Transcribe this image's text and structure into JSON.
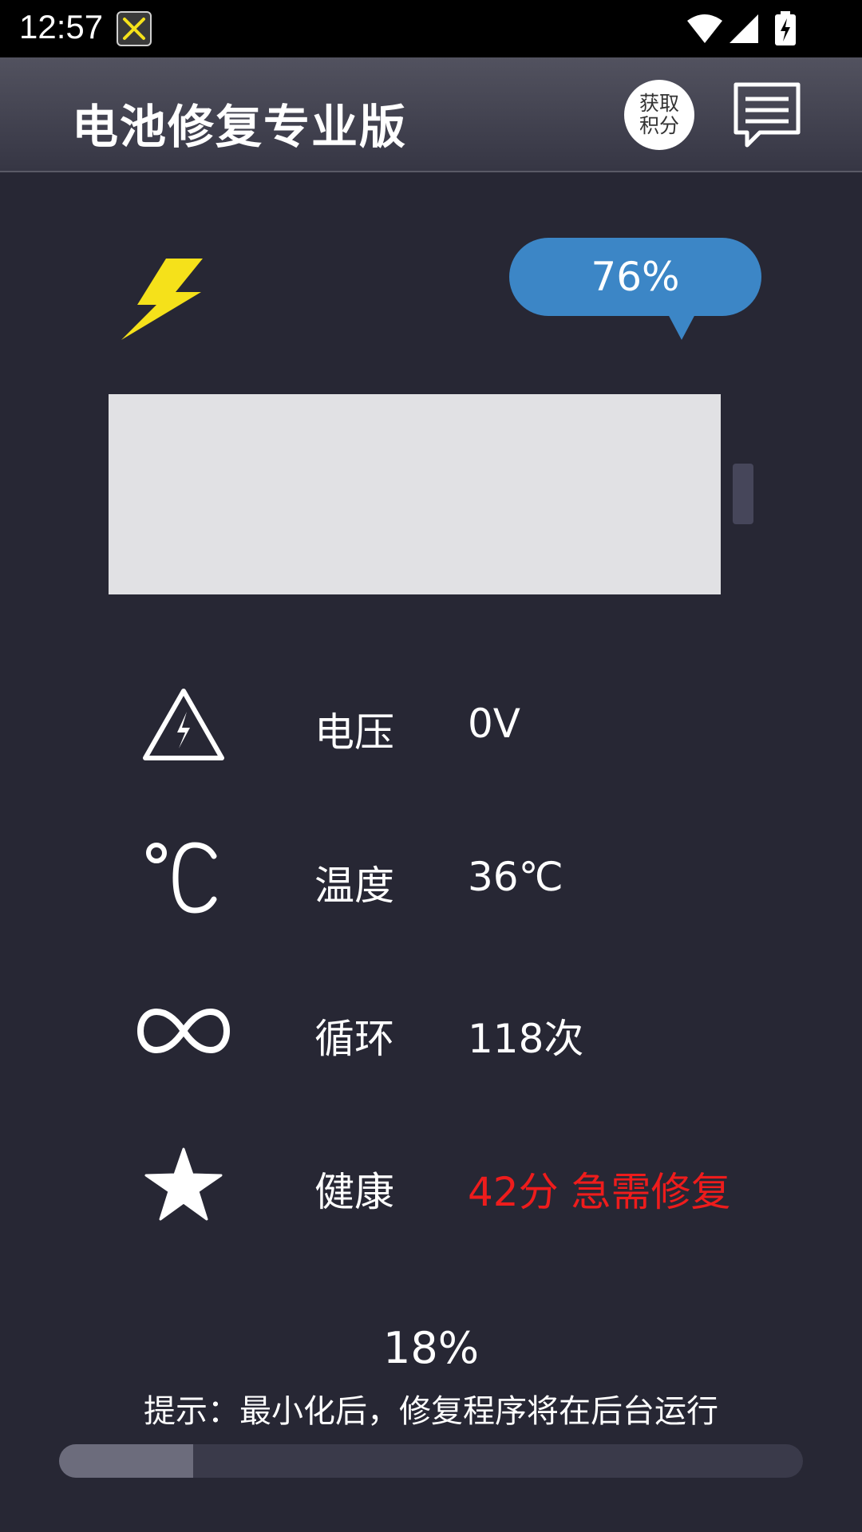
{
  "status_bar": {
    "time": "12:57",
    "icons": [
      "debug-tools-icon",
      "wifi-icon",
      "signal-icon",
      "battery-charging-icon"
    ]
  },
  "header": {
    "title": "电池修复专业版",
    "points_button_label": "获取积分",
    "message_icon": "message-icon"
  },
  "battery": {
    "charging_icon": "lightning-bolt-icon",
    "level_text": "76%",
    "level": 76
  },
  "info": [
    {
      "icon": "high-voltage-warning-icon",
      "label": "电压",
      "value": "0V"
    },
    {
      "icon": "celsius-icon",
      "label": "温度",
      "value": "36℃"
    },
    {
      "icon": "infinity-icon",
      "label": "循环",
      "value": "118次"
    },
    {
      "icon": "star-icon",
      "label": "健康",
      "value": "42分 急需修复"
    }
  ],
  "repair": {
    "progress_text": "18%",
    "progress": 0.18,
    "hint": "提示：最小化后，修复程序将在后台运行"
  },
  "colors": {
    "background": "#272734",
    "bubble": "#3c86c6",
    "bolt": "#f5e11a",
    "alert": "#ee1c1c"
  }
}
